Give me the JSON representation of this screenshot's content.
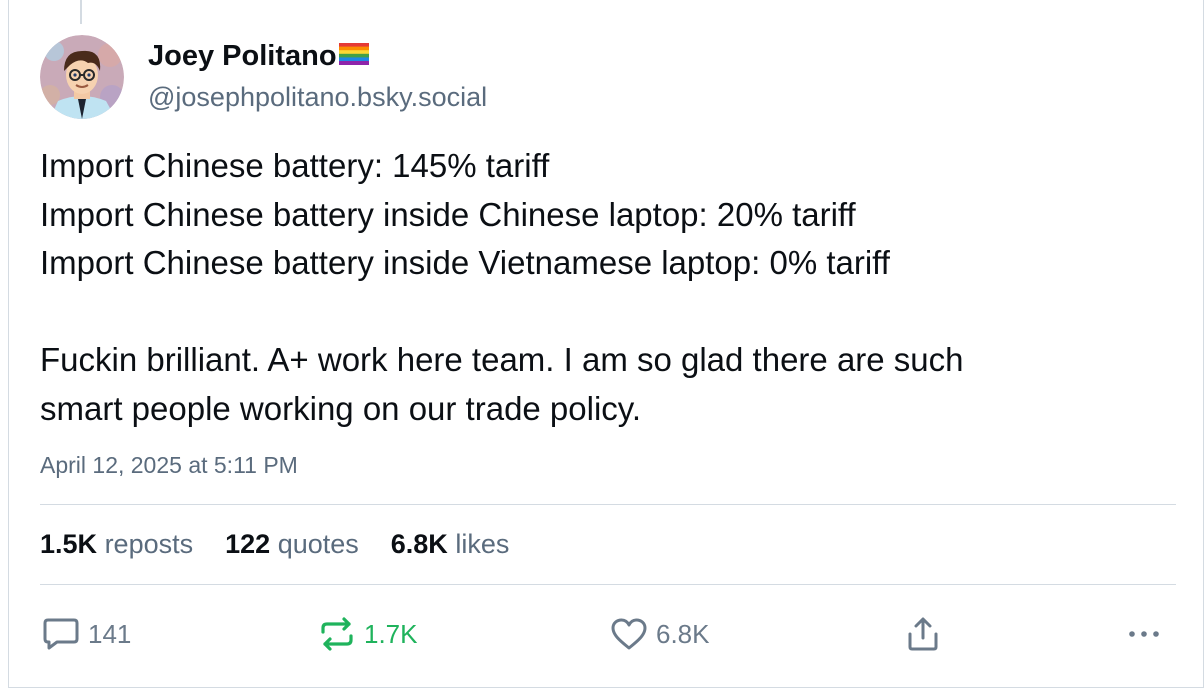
{
  "author": {
    "display_name": "Joey Politano",
    "handle": "@josephpolitano.bsky.social"
  },
  "post": {
    "lines": [
      "Import Chinese battery: 145% tariff",
      "Import Chinese battery inside Chinese laptop: 20% tariff",
      "Import Chinese battery inside Vietnamese laptop: 0% tariff",
      "",
      "Fuckin brilliant. A+ work here team. I am so glad there are such",
      "smart people working on our trade policy."
    ],
    "timestamp": "April 12, 2025 at 5:11 PM"
  },
  "stats": {
    "reposts_count": "1.5K",
    "reposts_label": "reposts",
    "quotes_count": "122",
    "quotes_label": "quotes",
    "likes_count": "6.8K",
    "likes_label": "likes"
  },
  "actions": {
    "reply_icon": "speech-bubble-icon",
    "reply_count": "141",
    "repost_icon": "repost-arrows-icon",
    "repost_count": "1.7K",
    "like_icon": "heart-icon",
    "like_count": "6.8K",
    "share_icon": "share-icon",
    "more_icon": "ellipsis-icon"
  },
  "colors": {
    "text_primary": "#0b0f14",
    "text_secondary": "#5a6b7d",
    "reposted_green": "#1fb35c",
    "border": "#d4dbe2"
  }
}
